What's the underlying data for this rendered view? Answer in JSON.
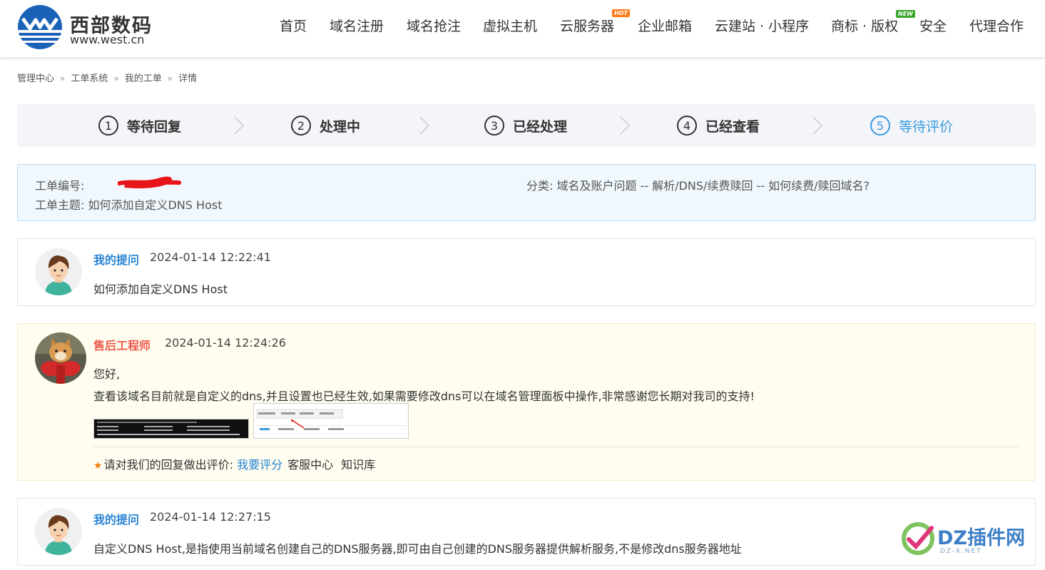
{
  "header": {
    "logo_name": "西部数码",
    "logo_domain": "www.west.cn",
    "nav": [
      {
        "label": "首页"
      },
      {
        "label": "域名注册"
      },
      {
        "label": "域名抢注"
      },
      {
        "label": "虚拟主机"
      },
      {
        "label": "云服务器",
        "badge": "HOT"
      },
      {
        "label": "企业邮箱"
      },
      {
        "label": "云建站 · 小程序"
      },
      {
        "label": "商标 · 版权",
        "badge": "NEW"
      },
      {
        "label": "安全"
      },
      {
        "label": "代理合作"
      }
    ]
  },
  "breadcrumb": [
    "管理中心",
    "工单系统",
    "我的工单",
    "详情"
  ],
  "steps": [
    {
      "num": "1",
      "label": "等待回复"
    },
    {
      "num": "2",
      "label": "处理中"
    },
    {
      "num": "3",
      "label": "已经处理"
    },
    {
      "num": "4",
      "label": "已经查看"
    },
    {
      "num": "5",
      "label": "等待评价",
      "active": true
    }
  ],
  "ticket": {
    "number_label": "工单编号:",
    "subject_label": "工单主题:",
    "subject": "如何添加自定义DNS Host",
    "category_label": "分类:",
    "category": "域名及账户问题 -- 解析/DNS/续费赎回 -- 如何续费/赎回域名?"
  },
  "messages": [
    {
      "author": "我的提问",
      "time": "2024-01-14 12:22:41",
      "text": "如何添加自定义DNS Host"
    },
    {
      "author": "售后工程师",
      "time": "2024-01-14 12:24:26",
      "greeting": "您好,",
      "text": "查看该域名目前就是自定义的dns,并且设置也已经生效,如果需要修改dns可以在域名管理面板中操作,非常感谢您长期对我司的支持!"
    },
    {
      "author": "我的提问",
      "time": "2024-01-14 12:27:15",
      "text": "自定义DNS Host,是指使用当前域名创建自己的DNS服务器,即可由自己创建的DNS服务器提供解析服务,不是修改dns服务器地址"
    }
  ],
  "rating": {
    "prompt": "请对我们的回复做出评价:",
    "rate_link": "我要评分",
    "service_center": "客服中心",
    "knowledge_base": "知识库"
  },
  "watermark": {
    "text": "DZ插件网",
    "sub": "DZ-X.NET"
  },
  "colors": {
    "link_blue": "#2a84d2",
    "staff_red": "#ee5b4d",
    "step_active": "#3a9be0",
    "info_bg": "#f0f8fd",
    "reply_bg": "#fffdf0"
  }
}
